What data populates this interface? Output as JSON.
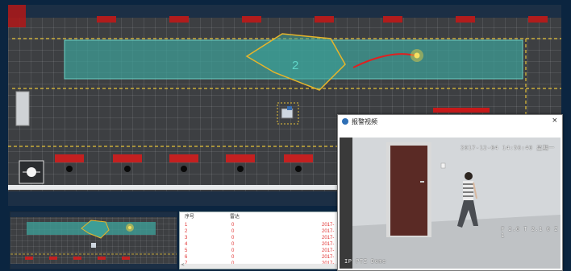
{
  "map": {
    "zone_label": "2"
  },
  "video_window": {
    "title": "报警视频",
    "close_label": "×",
    "osd_timestamp": "2017-12-04 14:56:40 星期一",
    "osd_right": "F 2.0 T 2.1 0 Z 1",
    "osd_camera": "IP PTZ Dome"
  },
  "track_panel": {
    "columns": [
      "序号",
      "雷达"
    ],
    "rows": [
      {
        "idx": "1",
        "radar": "0",
        "time": "2017-"
      },
      {
        "idx": "2",
        "radar": "0",
        "time": "2017-"
      },
      {
        "idx": "3",
        "radar": "0",
        "time": "2017-"
      },
      {
        "idx": "4",
        "radar": "0",
        "time": "2017-"
      },
      {
        "idx": "5",
        "radar": "0",
        "time": "2017-"
      },
      {
        "idx": "6",
        "radar": "0",
        "time": "2017-"
      },
      {
        "idx": "7",
        "radar": "0",
        "time": "2017-"
      }
    ],
    "scroll_left": "<"
  },
  "colors": {
    "zone_fill": "#3d9e96",
    "zone_border": "#e8b52a",
    "track": "#e02020",
    "row_text": "#e03030"
  }
}
